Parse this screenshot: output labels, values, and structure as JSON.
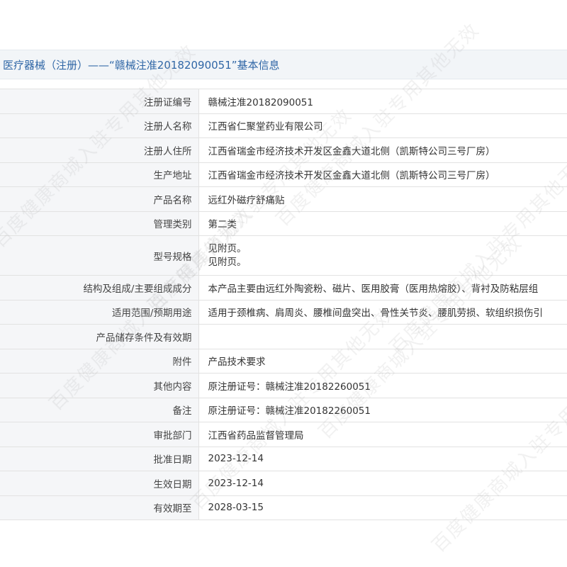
{
  "header": {
    "title": "医疗器械（注册）——“赣械注准20182090051”基本信息"
  },
  "rows": [
    {
      "label": "注册证编号",
      "value": "赣械注准20182090051"
    },
    {
      "label": "注册人名称",
      "value": "江西省仁聚堂药业有限公司"
    },
    {
      "label": "注册人住所",
      "value": "江西省瑞金市经济技术开发区金鑫大道北侧（凯斯特公司三号厂房）"
    },
    {
      "label": "生产地址",
      "value": "江西省瑞金市经济技术开发区金鑫大道北侧（凯斯特公司三号厂房）"
    },
    {
      "label": "产品名称",
      "value": "远红外磁疗舒痛贴"
    },
    {
      "label": "管理类别",
      "value": "第二类"
    },
    {
      "label": "型号规格",
      "value": "见附页。",
      "value2": "见附页。"
    },
    {
      "label": "结构及组成/主要组成成分",
      "value": "本产品主要由远红外陶瓷粉、磁片、医用胶膏（医用热熔胶）、背衬及防粘层组"
    },
    {
      "label": "适用范围/预期用途",
      "value": "适用于颈椎病、肩周炎、腰椎间盘突出、骨性关节炎、腰肌劳损、软组织损伤引"
    },
    {
      "label": "产品储存条件及有效期",
      "value": ""
    },
    {
      "label": "附件",
      "value": "产品技术要求"
    },
    {
      "label": "其他内容",
      "value": "原注册证号：赣械注准20182260051"
    },
    {
      "label": "备注",
      "value": "原注册证号：赣械注准20182260051"
    },
    {
      "label": "审批部门",
      "value": "江西省药品监督管理局"
    },
    {
      "label": "批准日期",
      "value": "2023-12-14"
    },
    {
      "label": "生效日期",
      "value": "2023-12-14"
    },
    {
      "label": "有效期至",
      "value": "2028-03-15"
    }
  ],
  "watermark": {
    "text": "百度健康商城入驻专用其他无效"
  }
}
